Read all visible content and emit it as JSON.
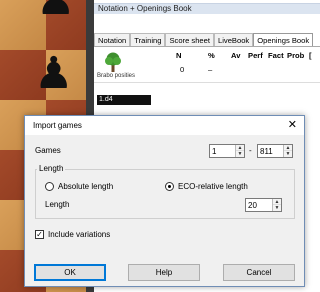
{
  "notation": {
    "title": "Notation + Openings Book",
    "tabs": [
      "Notation",
      "Training",
      "Score sheet",
      "LiveBook",
      "Openings Book"
    ],
    "active_tab": "Openings Book",
    "headers": [
      "N",
      "%",
      "Av",
      "Perf",
      "Fact",
      "Prob",
      "["
    ],
    "values": {
      "N": "0",
      "percent": "–"
    },
    "book_label": "Brabo posities",
    "selected_move": "1.d4"
  },
  "dialog": {
    "title": "Import games",
    "close_glyph": "✕",
    "games_label": "Games",
    "games_from": "1",
    "games_dash": "-",
    "games_to": "811",
    "length_group": "Length",
    "absolute_length": "Absolute length",
    "eco_relative_length": "ECO-relative length",
    "selected_option": "eco_relative",
    "length_label": "Length",
    "length_value": "20",
    "include_variations": "Include variations",
    "include_variations_checked": true,
    "ok": "OK",
    "help": "Help",
    "cancel": "Cancel"
  },
  "icons": {
    "pawn": "♟",
    "check": "✓",
    "arrow_up": "▲",
    "arrow_down": "▼",
    "tree": "tree-icon"
  },
  "colors": {
    "dialog_border": "#6f8db5",
    "default_button": "#0078d7",
    "tab_bar": "#dbe4f0"
  }
}
